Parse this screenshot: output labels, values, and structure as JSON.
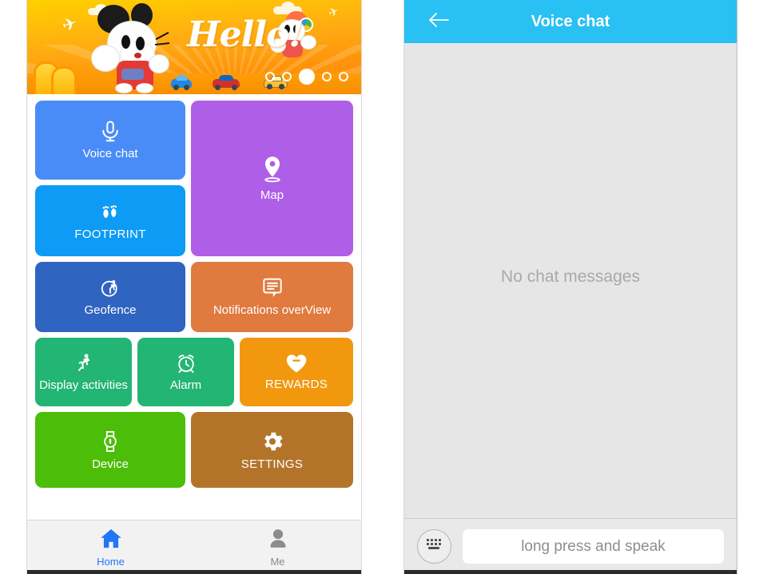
{
  "left_phone": {
    "banner": {
      "greeting": "Hello!",
      "pager": {
        "total": 5,
        "active_index": 2
      }
    },
    "tiles": [
      {
        "label": "Voice chat",
        "icon": "microphone-icon",
        "color": "#4a8cf7",
        "name": "tile-voice-chat"
      },
      {
        "label": "FOOTPRINT",
        "icon": "footprints-icon",
        "color": "#0d9bf5",
        "name": "tile-footprint"
      },
      {
        "label": "Map",
        "icon": "map-pin-icon",
        "color": "#af5ee8",
        "name": "tile-map"
      },
      {
        "label": "Geofence",
        "icon": "geofence-icon",
        "color": "#2f64c0",
        "name": "tile-geofence"
      },
      {
        "label": "Notifications overView",
        "icon": "notification-bubble-icon",
        "color": "#e07a3f",
        "name": "tile-notifications-overview"
      },
      {
        "label": "Display activities",
        "icon": "running-person-icon",
        "color": "#22b573",
        "name": "tile-display-activities"
      },
      {
        "label": "Alarm",
        "icon": "alarm-clock-icon",
        "color": "#22b573",
        "name": "tile-alarm"
      },
      {
        "label": "REWARDS",
        "icon": "heart-icon",
        "color": "#f2980f",
        "name": "tile-rewards"
      },
      {
        "label": "Device",
        "icon": "watch-icon",
        "color": "#4cbd08",
        "name": "tile-device"
      },
      {
        "label": "SETTINGS",
        "icon": "gear-icon",
        "color": "#b3742a",
        "name": "tile-settings"
      }
    ],
    "tabbar": {
      "items": [
        {
          "label": "Home",
          "icon": "home-icon",
          "active": true,
          "color": "#2176f5"
        },
        {
          "label": "Me",
          "icon": "person-icon",
          "active": false,
          "color": "#8a8a8a"
        }
      ]
    }
  },
  "right_phone": {
    "header": {
      "title": "Voice chat",
      "back_icon": "arrow-left-icon",
      "bar_color": "#29c0f3"
    },
    "chat": {
      "empty_state": "No chat messages"
    },
    "input": {
      "keyboard_icon": "keyboard-icon",
      "speak_label": "long press and speak"
    }
  }
}
